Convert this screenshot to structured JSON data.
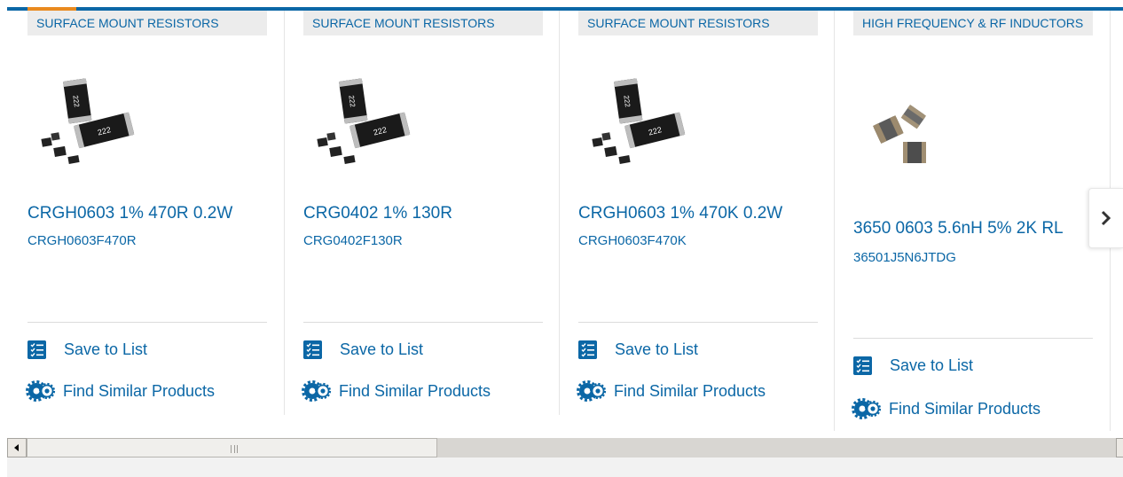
{
  "products": [
    {
      "category": "SURFACE MOUNT RESISTORS",
      "name": "CRGH0603 1% 470R 0.2W",
      "part_number": "CRGH0603F470R",
      "image_icon": "smd-resistor-image",
      "save_label": "Save to List",
      "similar_label": "Find Similar Products"
    },
    {
      "category": "SURFACE MOUNT RESISTORS",
      "name": "CRG0402 1% 130R",
      "part_number": "CRG0402F130R",
      "image_icon": "smd-resistor-image",
      "save_label": "Save to List",
      "similar_label": "Find Similar Products"
    },
    {
      "category": "SURFACE MOUNT RESISTORS",
      "name": "CRGH0603 1% 470K 0.2W",
      "part_number": "CRGH0603F470K",
      "image_icon": "smd-resistor-image",
      "save_label": "Save to List",
      "similar_label": "Find Similar Products"
    },
    {
      "category": "HIGH FREQUENCY & RF INDUCTORS",
      "name": "3650 0603 5.6nH 5% 2K RL",
      "part_number": "36501J5N6JTDG",
      "image_icon": "rf-inductor-image",
      "save_label": "Save to List",
      "similar_label": "Find Similar Products"
    }
  ],
  "resistor_marking": "222",
  "carousel": {
    "next_icon": "chevron-right-icon"
  },
  "colors": {
    "accent": "#0b67a6",
    "orange": "#e98a1f",
    "category_bg": "#ececec"
  }
}
